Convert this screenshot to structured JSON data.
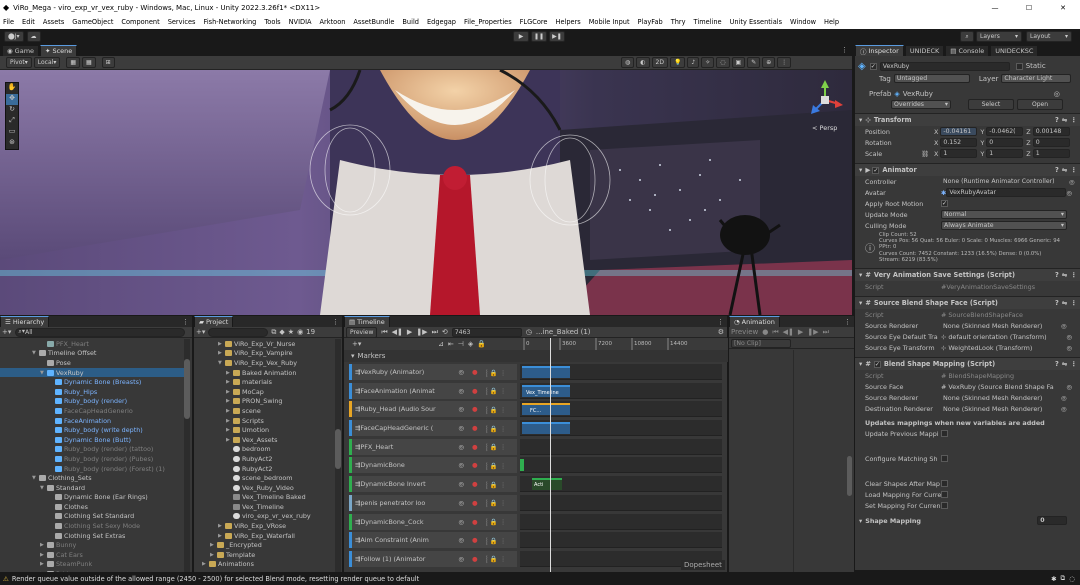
{
  "window": {
    "title": "ViRo_Mega - viro_exp_vr_vex_ruby - Windows, Mac, Linux - Unity 2022.3.26f1* <DX11>",
    "min": "—",
    "max": "☐",
    "close": "✕"
  },
  "menu": [
    "File",
    "Edit",
    "Assets",
    "GameObject",
    "Component",
    "Services",
    "Fish-Networking",
    "Tools",
    "NVIDIA",
    "Arktoon",
    "AssetBundle",
    "Build",
    "Edgegap",
    "File_Properties",
    "FLGCore",
    "Helpers",
    "Mobile Input",
    "PlayFab",
    "Thry",
    "Timeline",
    "Unity Essentials",
    "Window",
    "Help"
  ],
  "toolbar": {
    "account": "J",
    "layers": "Layers",
    "layout": "Layout"
  },
  "scene": {
    "tabs": [
      "Game",
      "Scene"
    ],
    "pivot": "Pivot",
    "local": "Local",
    "mode2d": "2D",
    "persp": "< Persp"
  },
  "hierarchy": {
    "title": "Hierarchy",
    "search": "All",
    "items": [
      {
        "indent": 5,
        "label": "PFX_Heart",
        "arrow": "",
        "color": "grey",
        "icon": "#8aa"
      },
      {
        "indent": 4,
        "label": "Timeline Offset",
        "arrow": "▼",
        "color": "",
        "icon": "#aaa"
      },
      {
        "indent": 5,
        "label": "Pose",
        "arrow": "",
        "color": "",
        "icon": "#aaa"
      },
      {
        "indent": 5,
        "label": "VexRuby",
        "arrow": "▼",
        "color": "",
        "icon": "#5fb3ff",
        "selected": true
      },
      {
        "indent": 6,
        "label": "Dynamic Bone (Breasts)",
        "arrow": "",
        "color": "blue",
        "icon": "#5fb3ff"
      },
      {
        "indent": 6,
        "label": "Ruby_Hips",
        "arrow": "",
        "color": "blue",
        "icon": "#5fb3ff"
      },
      {
        "indent": 6,
        "label": "Ruby_body (render)",
        "arrow": "",
        "color": "blue",
        "icon": "#5fb3ff"
      },
      {
        "indent": 6,
        "label": "FaceCapHeadGenerio",
        "arrow": "",
        "color": "grey",
        "icon": "#5fb3ff"
      },
      {
        "indent": 6,
        "label": "FaceAnimation",
        "arrow": "",
        "color": "blue",
        "icon": "#5fb3ff"
      },
      {
        "indent": 6,
        "label": "Ruby_body (write depth)",
        "arrow": "",
        "color": "blue",
        "icon": "#5fb3ff"
      },
      {
        "indent": 6,
        "label": "Dynamic Bone (Butt)",
        "arrow": "",
        "color": "blue",
        "icon": "#5fb3ff"
      },
      {
        "indent": 6,
        "label": "Ruby_body (render) (tattoo)",
        "arrow": "",
        "color": "grey",
        "icon": "#5fb3ff"
      },
      {
        "indent": 6,
        "label": "Ruby_body (render) (Pubes)",
        "arrow": "",
        "color": "grey",
        "icon": "#5fb3ff"
      },
      {
        "indent": 6,
        "label": "Ruby_body (render) (Forest) (1)",
        "arrow": "",
        "color": "grey",
        "icon": "#5fb3ff"
      },
      {
        "indent": 4,
        "label": "Clothing_Sets",
        "arrow": "▼",
        "color": "",
        "icon": "#aaa"
      },
      {
        "indent": 5,
        "label": "Standard",
        "arrow": "▼",
        "color": "",
        "icon": "#aaa"
      },
      {
        "indent": 6,
        "label": "Dynamic Bone (Ear Rings)",
        "arrow": "",
        "color": "",
        "icon": "#aaa"
      },
      {
        "indent": 6,
        "label": "Clothes",
        "arrow": "",
        "color": "",
        "icon": "#aaa"
      },
      {
        "indent": 6,
        "label": "Clothing Set Standard",
        "arrow": "",
        "color": "",
        "icon": "#aaa"
      },
      {
        "indent": 6,
        "label": "Clothing Set Sexy Mode",
        "arrow": "",
        "color": "grey",
        "icon": "#aaa"
      },
      {
        "indent": 6,
        "label": "Clothing Set Extras",
        "arrow": "",
        "color": "",
        "icon": "#aaa"
      },
      {
        "indent": 5,
        "label": "Bunny",
        "arrow": "▶",
        "color": "grey",
        "icon": "#aaa"
      },
      {
        "indent": 5,
        "label": "Cat Ears",
        "arrow": "▶",
        "color": "grey",
        "icon": "#aaa"
      },
      {
        "indent": 5,
        "label": "SteamPunk",
        "arrow": "▶",
        "color": "grey",
        "icon": "#aaa"
      },
      {
        "indent": 5,
        "label": "Pride",
        "arrow": "▶",
        "color": "grey",
        "icon": "#aaa"
      }
    ]
  },
  "project": {
    "title": "Project",
    "count": "19",
    "items": [
      {
        "indent": 3,
        "label": "ViRo_Exp_Vr_Nurse",
        "arrow": "▶",
        "icon": "folder"
      },
      {
        "indent": 3,
        "label": "ViRo_Exp_Vampire",
        "arrow": "▶",
        "icon": "folder"
      },
      {
        "indent": 3,
        "label": "ViRo_Exp_Vex_Ruby",
        "arrow": "▼",
        "icon": "folder"
      },
      {
        "indent": 4,
        "label": "Baked Animation",
        "arrow": "▶",
        "icon": "folder"
      },
      {
        "indent": 4,
        "label": "materials",
        "arrow": "▶",
        "icon": "folder"
      },
      {
        "indent": 4,
        "label": "MoCap",
        "arrow": "▶",
        "icon": "folder"
      },
      {
        "indent": 4,
        "label": "PRON_Swing",
        "arrow": "▶",
        "icon": "folder"
      },
      {
        "indent": 4,
        "label": "scene",
        "arrow": "▶",
        "icon": "folder"
      },
      {
        "indent": 4,
        "label": "Scripts",
        "arrow": "▶",
        "icon": "folder"
      },
      {
        "indent": 4,
        "label": "Umotion",
        "arrow": "▶",
        "icon": "folder"
      },
      {
        "indent": 4,
        "label": "Vex_Assets",
        "arrow": "▶",
        "icon": "folder"
      },
      {
        "indent": 4,
        "label": "bedroom",
        "arrow": "",
        "icon": "unity"
      },
      {
        "indent": 4,
        "label": "RubyAct2",
        "arrow": "",
        "icon": "unity"
      },
      {
        "indent": 4,
        "label": "RubyAct2",
        "arrow": "",
        "icon": "unity"
      },
      {
        "indent": 4,
        "label": "scene_bedroom",
        "arrow": "",
        "icon": "unity"
      },
      {
        "indent": 4,
        "label": "Vex_Ruby_Video",
        "arrow": "",
        "icon": "unity"
      },
      {
        "indent": 4,
        "label": "Vex_Timeline Baked",
        "arrow": "",
        "icon": "tl"
      },
      {
        "indent": 4,
        "label": "Vex_Timeline",
        "arrow": "",
        "icon": "tl"
      },
      {
        "indent": 4,
        "label": "viro_exp_vr_vex_ruby",
        "arrow": "",
        "icon": "unity"
      },
      {
        "indent": 3,
        "label": "ViRo_Exp_VRose",
        "arrow": "▶",
        "icon": "folder"
      },
      {
        "indent": 3,
        "label": "ViRo_Exp_Waterfall",
        "arrow": "▶",
        "icon": "folder"
      },
      {
        "indent": 2,
        "label": "_Encrypted",
        "arrow": "▶",
        "icon": "folder"
      },
      {
        "indent": 2,
        "label": "Template",
        "arrow": "▶",
        "icon": "folder"
      },
      {
        "indent": 1,
        "label": "Animations",
        "arrow": "▶",
        "icon": "folder"
      }
    ]
  },
  "timeline": {
    "title": "Timeline",
    "preview": "Preview",
    "frame": "7463",
    "asset": "...ine_Baked (1)",
    "ruler": [
      "0",
      "3600",
      "7200",
      "10800",
      "14400"
    ],
    "markers": "Markers",
    "tracks": [
      {
        "label": "VexRuby (Animator)",
        "color": "#3b8ed8"
      },
      {
        "label": "FaceAnimation (Animat",
        "color": "#3b8ed8"
      },
      {
        "label": "Ruby_Head (Audio Sour",
        "color": "#e8a524"
      },
      {
        "label": "FaceCapHeadGeneric (",
        "color": "#3b8ed8"
      },
      {
        "label": "PFX_Heart",
        "color": "#2fae4f"
      },
      {
        "label": "DynamicBone",
        "color": "#2fae4f"
      },
      {
        "label": "DynamicBone Invert",
        "color": "#2fae4f"
      },
      {
        "label": "penis penetrator loo",
        "color": "#7aa7c7"
      },
      {
        "label": "DynamicBone_Cock",
        "color": "#2fae4f"
      },
      {
        "label": "Aim Constraint (Anim",
        "color": "#3b8ed8"
      },
      {
        "label": "Follow (1) (Animator",
        "color": "#3b8ed8"
      }
    ],
    "clips": [
      "Vex_Timeline",
      "FC...",
      "Acti"
    ],
    "dopesheet": "Dopesheet"
  },
  "animation": {
    "title": "Animation",
    "preview": "Preview",
    "clip": "[No Clip]"
  },
  "inspector": {
    "tabs": [
      "Inspector",
      "UNIDECK",
      "Console",
      "UNIDECKSC"
    ],
    "name": "VexRuby",
    "static": "Static",
    "tag": "Tag",
    "tag_val": "Untagged",
    "layer": "Layer",
    "layer_val": "Character Light",
    "prefab": "Prefab",
    "prefab_val": "VexRuby",
    "overrides": "Overrides",
    "select": "Select",
    "open": "Open",
    "transform": {
      "title": "Transform",
      "rows": [
        {
          "label": "Position",
          "x": "-0.04161",
          "y": "-0.0462(",
          "z": "0.00148"
        },
        {
          "label": "Rotation",
          "x": "0.152",
          "y": "0",
          "z": "0"
        },
        {
          "label": "Scale",
          "x": "1",
          "y": "1",
          "z": "1"
        }
      ]
    },
    "animator": {
      "title": "Animator",
      "controller": "None (Runtime Animator Controller)",
      "avatar": "VexRubyAvatar",
      "root_motion": "✓",
      "update": "Normal",
      "culling": "Always Animate",
      "labels": [
        "Controller",
        "Avatar",
        "Apply Root Motion",
        "Update Mode",
        "Culling Mode"
      ],
      "info": [
        "Clip Count: 52",
        "Curves Pos: 56 Quat: 56 Euler: 0 Scale: 0 Muscles: 6966 Generic: 94 PPtr: 0",
        "Curves Count: 7452 Constant: 1233 (16.5%) Dense: 0 (0.0%)",
        "Stream: 6219 (83.5%)"
      ]
    },
    "very": {
      "title": "Very Animation Save Settings (Script)",
      "script_label": "Script",
      "script": "VeryAnimationSaveSettings"
    },
    "blendface": {
      "title": "Source Blend Shape Face (Script)",
      "labels": [
        "Script",
        "Source Renderer",
        "Source Eye Default Tra",
        "Source Eye Transform"
      ],
      "values": [
        "SourceBlendShapeFace",
        "None (Skinned Mesh Renderer)",
        "default orientation (Transform)",
        "WeightedLook (Transform)"
      ]
    },
    "mapping": {
      "title": "Blend Shape Mapping (Script)",
      "labels": [
        "Script",
        "Source Face",
        "Source Renderer",
        "Destination Renderer"
      ],
      "values": [
        "BlendShapeMapping",
        "VexRuby (Source Blend Shape Fa",
        "None (Skinned Mesh Renderer)",
        "None (Skinned Mesh Renderer)"
      ],
      "note": "Updates mappings when new variables are added",
      "checks": [
        "Update Previous Mappi",
        "Configure Matching Sh",
        "Clear Shapes After Map",
        "Load Mapping For Curre",
        "Set Mapping For Curren"
      ],
      "section": "Shape Mapping",
      "section_val": "0"
    }
  },
  "status": {
    "text": "Render queue value outside of the allowed range (2450 - 2500) for selected Blend mode, resetting render queue to default"
  }
}
